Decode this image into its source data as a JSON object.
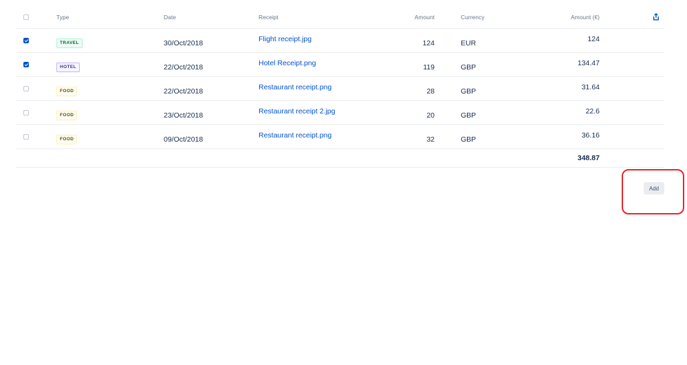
{
  "header": {
    "type": "Type",
    "date": "Date",
    "receipt": "Receipt",
    "amount": "Amount",
    "currency": "Currency",
    "amount_eur": "Amount (€)",
    "share_icon": "share-icon"
  },
  "rows": [
    {
      "checked": true,
      "type": "TRAVEL",
      "date": "30/Oct/2018",
      "receipt": "Flight receipt.jpg",
      "amount": "124",
      "currency": "EUR",
      "amount_eur": "124"
    },
    {
      "checked": true,
      "type": "HOTEL",
      "date": "22/Oct/2018",
      "receipt": "Hotel Receipt.png",
      "amount": "119",
      "currency": "GBP",
      "amount_eur": "134.47"
    },
    {
      "checked": false,
      "type": "FOOD",
      "date": "22/Oct/2018",
      "receipt": "Restaurant receipt.png",
      "amount": "28",
      "currency": "GBP",
      "amount_eur": "31.64"
    },
    {
      "checked": false,
      "type": "FOOD",
      "date": "23/Oct/2018",
      "receipt": "Restaurant receipt 2.jpg",
      "amount": "20",
      "currency": "GBP",
      "amount_eur": "22.6"
    },
    {
      "checked": false,
      "type": "FOOD",
      "date": "09/Oct/2018",
      "receipt": "Restaurant receipt.png",
      "amount": "32",
      "currency": "GBP",
      "amount_eur": "36.16"
    }
  ],
  "total": "348.87",
  "add_button": "Add",
  "colors": {
    "link": "#0052cc",
    "checkbox_checked": "#0052cc",
    "travel": "#006644",
    "hotel": "#403294",
    "food": "#5e4c00",
    "highlight": "#e5252a"
  }
}
